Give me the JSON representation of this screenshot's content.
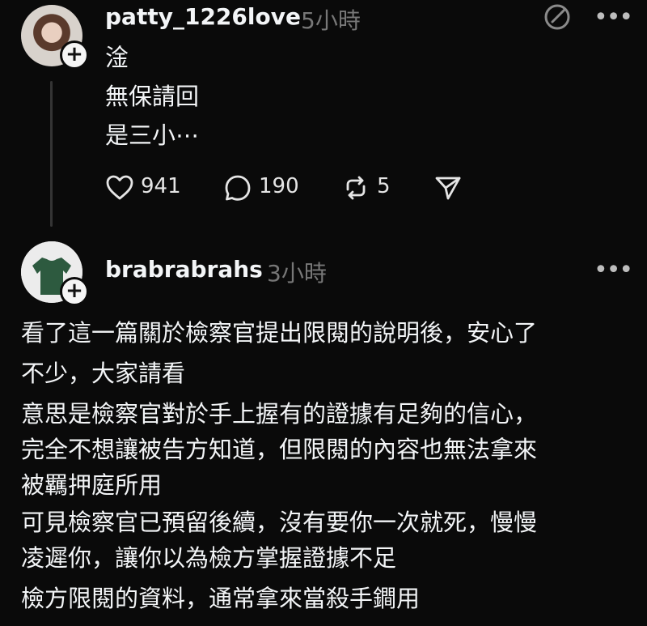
{
  "post1": {
    "username": "patty_1226love",
    "time": "5小時",
    "lines": [
      "淦",
      "無保請回",
      "是三小⋯"
    ],
    "likes": "941",
    "comments": "190",
    "reposts": "5"
  },
  "post2": {
    "username": "brabrabrahs",
    "time": "3小時",
    "lines": [
      "看了這一篇關於檢察官提出限閱的說明後，安心了",
      "不少，大家請看",
      "意思是檢察官對於手上握有的證據有足夠的信心，",
      "完全不想讓被告方知道，但限閱的內容也無法拿來",
      "被羈押庭所用",
      "可見檢察官已預留後續，沒有要你一次就死，慢慢",
      "凌遲你，讓你以為檢方掌握證據不足",
      "檢方限閱的資料，通常拿來當殺手鐧用"
    ]
  },
  "icons": {
    "follow": "+",
    "more": "•••"
  }
}
